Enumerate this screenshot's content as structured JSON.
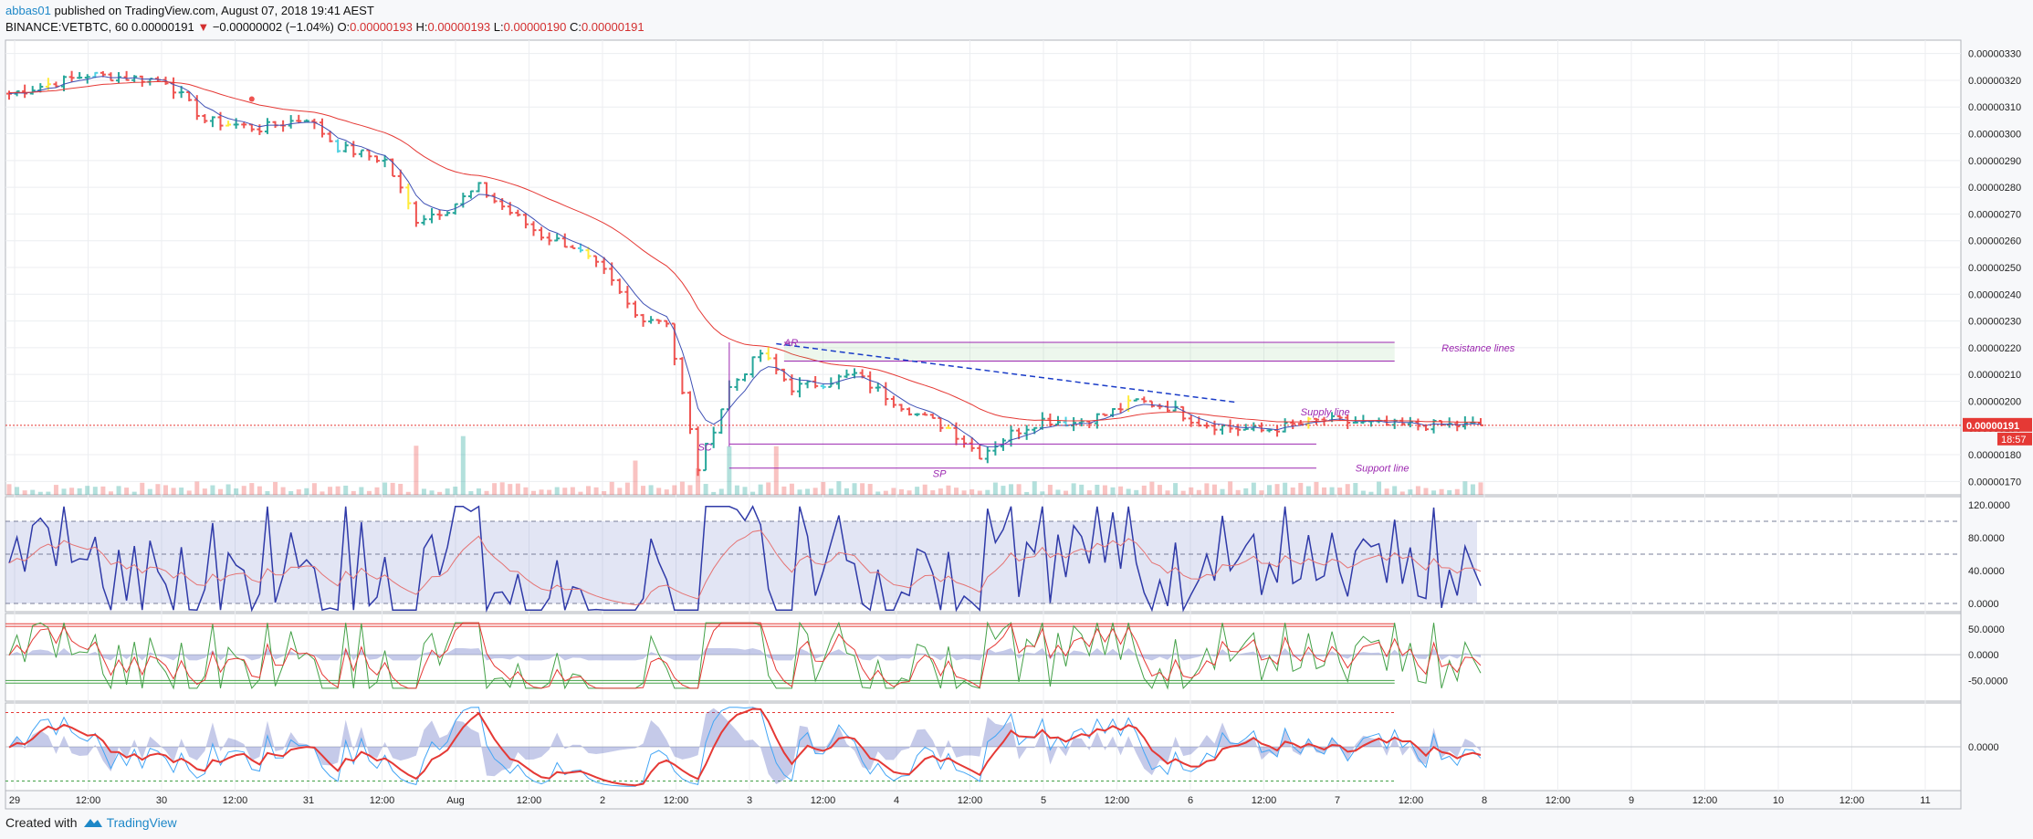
{
  "header": {
    "user": "abbas01",
    "published": " published on TradingView.com, August 07, 2018 19:41 AEST",
    "symbol": "BINANCE:VETBTC, 60",
    "last": "0.00000191",
    "arrow": "▼",
    "change": "−0.00000002 (−1.04%)",
    "o_label": "O:",
    "o": "0.00000193",
    "h_label": "H:",
    "h": "0.00000193",
    "l_label": "L:",
    "l": "0.00000190",
    "c_label": "C:",
    "c": "0.00000191"
  },
  "footer": {
    "created": "Created with",
    "brand": "TradingView",
    "logo_icon": "tradingview-logo-icon"
  },
  "colors": {
    "up": "#26a69a",
    "down": "#ef5350",
    "ema_fast": "#3f51b5",
    "ema_slow": "#e53935",
    "annot": "#9c27b0",
    "accent": "#1e88c8"
  },
  "chart_data": {
    "type": "candlestick",
    "symbol": "BINANCE:VETBTC",
    "interval": "60",
    "x_tick_labels": [
      "29",
      "12:00",
      "30",
      "12:00",
      "31",
      "12:00",
      "Aug",
      "12:00",
      "2",
      "12:00",
      "3",
      "12:00",
      "4",
      "12:00",
      "5",
      "12:00",
      "6",
      "12:00",
      "7",
      "12:00",
      "8",
      "12:00",
      "9",
      "12:00",
      "10",
      "12:00",
      "11"
    ],
    "price_axis_labels": [
      "0.00000330",
      "0.00000320",
      "0.00000310",
      "0.00000300",
      "0.00000290",
      "0.00000280",
      "0.00000270",
      "0.00000260",
      "0.00000250",
      "0.00000240",
      "0.00000230",
      "0.00000220",
      "0.00000210",
      "0.00000200",
      "0.00000190",
      "0.00000180",
      "0.00000170"
    ],
    "price_range": [
      1.65e-06,
      3.35e-06
    ],
    "last_price_label": "0.00000191",
    "countdown_label": "18:57",
    "price_path_x": [
      0,
      10,
      20,
      25,
      32,
      38,
      42,
      48,
      52,
      56,
      60,
      62,
      68,
      72,
      76,
      80,
      84,
      88,
      92,
      96,
      100,
      104,
      108,
      112,
      116,
      120,
      124,
      128,
      132,
      136,
      140,
      144,
      148,
      152,
      156,
      160,
      164,
      168,
      172,
      176,
      180,
      184,
      188
    ],
    "price_path_close": [
      3.15e-06,
      3.22e-06,
      3.2e-06,
      3.05e-06,
      3.02e-06,
      3.06e-06,
      2.95e-06,
      2.9e-06,
      2.68e-06,
      2.72e-06,
      2.8e-06,
      2.75e-06,
      2.62e-06,
      2.58e-06,
      2.48e-06,
      2.32e-06,
      2.3e-06,
      1.75e-06,
      2.05e-06,
      2.18e-06,
      2.05e-06,
      2.07e-06,
      2.1e-06,
      2.02e-06,
      1.95e-06,
      1.9e-06,
      1.8e-06,
      1.88e-06,
      1.93e-06,
      1.92e-06,
      1.95e-06,
      2e-06,
      1.98e-06,
      1.92e-06,
      1.9e-06,
      1.89e-06,
      1.91e-06,
      1.93e-06,
      1.92e-06,
      1.91e-06,
      1.91e-06,
      1.91e-06,
      1.91e-06
    ],
    "annotations": [
      {
        "text": "AR",
        "price": 2.22e-06
      },
      {
        "text": "SC",
        "price": 1.83e-06
      },
      {
        "text": "SP",
        "price": 1.73e-06
      },
      {
        "text": "Resistance lines",
        "price": 2.2e-06
      },
      {
        "text": "Supply line",
        "price": 1.96e-06
      },
      {
        "text": "Support line",
        "price": 1.75e-06
      }
    ],
    "resistance_levels": [
      2.22e-06,
      2.15e-06
    ],
    "support_levels": [
      1.84e-06,
      1.75e-06
    ],
    "rsi": {
      "axis_labels": [
        "120.0000",
        "80.0000",
        "40.0000",
        "0.0000"
      ],
      "range": [
        -10,
        130
      ],
      "band": [
        0,
        100
      ],
      "mid": 60
    },
    "stoch": {
      "axis_labels": [
        "50.0000",
        "0.0000",
        "-50.0000"
      ],
      "range": [
        -90,
        80
      ],
      "upper_lines": [
        60,
        55
      ],
      "lower_lines": [
        -55,
        -50
      ]
    },
    "macd": {
      "axis_labels": [
        "0.0000"
      ],
      "range": [
        -1,
        1
      ]
    }
  }
}
